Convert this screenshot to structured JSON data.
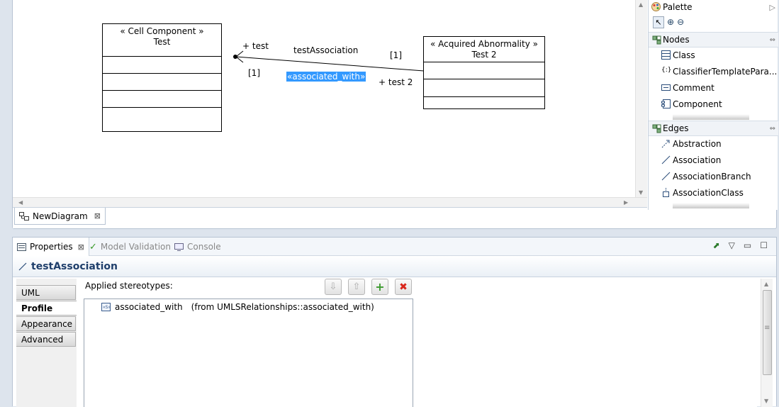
{
  "diagram": {
    "class_left": {
      "stereotype": "« Cell Component »",
      "name": "Test"
    },
    "class_right": {
      "stereotype": "« Acquired Abnormality »",
      "name": "Test 2"
    },
    "association": {
      "name": "testAssociation",
      "stereotype_label": "«associated_with»",
      "end_left_role": "+ test",
      "end_left_multiplicity": "[1]",
      "end_right_multiplicity": "[1]",
      "end_right_role": "+ test 2"
    }
  },
  "editor_tab": {
    "label": "NewDiagram",
    "icon": "diagram-icon"
  },
  "palette": {
    "title": "Palette",
    "nodes_header": "Nodes",
    "nodes": [
      {
        "label": "Class",
        "icon": "class-icon"
      },
      {
        "label": "ClassifierTemplatePara...",
        "icon": "template-parameter-icon"
      },
      {
        "label": "Comment",
        "icon": "comment-icon"
      },
      {
        "label": "Component",
        "icon": "component-icon"
      }
    ],
    "edges_header": "Edges",
    "edges": [
      {
        "label": "Abstraction",
        "icon": "abstraction-icon"
      },
      {
        "label": "Association",
        "icon": "association-icon"
      },
      {
        "label": "AssociationBranch",
        "icon": "association-branch-icon"
      },
      {
        "label": "AssociationClass",
        "icon": "association-class-icon"
      }
    ]
  },
  "views": {
    "tabs": [
      {
        "label": "Properties",
        "active": true
      },
      {
        "label": "Model Validation",
        "active": false
      },
      {
        "label": "Console",
        "active": false
      }
    ]
  },
  "properties": {
    "title": "testAssociation",
    "side_tabs": [
      "UML",
      "Profile",
      "Appearance",
      "Advanced"
    ],
    "selected_side_tab": "Profile",
    "applied_stereotypes_label": "Applied stereotypes:",
    "stereotypes": [
      {
        "name": "associated_with",
        "source": "(from UMLSRelationships::associated_with)"
      }
    ]
  },
  "colors": {
    "selection": "#3399ff",
    "title": "#1f3f6b",
    "delete_red": "#d9261c",
    "add_green": "#3c9a2e"
  }
}
